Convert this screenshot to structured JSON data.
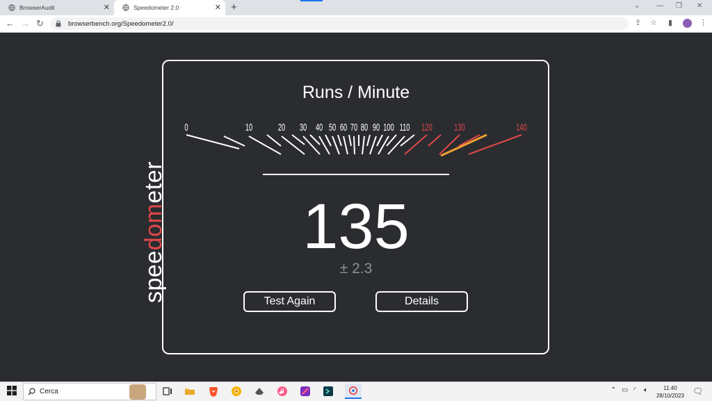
{
  "browser": {
    "tabs": [
      {
        "title": "BrowserAudit",
        "active": false
      },
      {
        "title": "Speedometer 2.0",
        "active": true
      }
    ],
    "new_tab_label": "+",
    "url": "browserbench.org/Speedometer2.0/"
  },
  "page": {
    "logo_text": "speedometer",
    "title": "Runs / Minute",
    "gauge_labels": [
      {
        "text": "0",
        "color": "#ffffff"
      },
      {
        "text": "10",
        "color": "#ffffff"
      },
      {
        "text": "20",
        "color": "#ffffff"
      },
      {
        "text": "30",
        "color": "#ffffff"
      },
      {
        "text": "40",
        "color": "#ffffff"
      },
      {
        "text": "50",
        "color": "#ffffff"
      },
      {
        "text": "60",
        "color": "#ffffff"
      },
      {
        "text": "70",
        "color": "#ffffff"
      },
      {
        "text": "80",
        "color": "#ffffff"
      },
      {
        "text": "90",
        "color": "#ffffff"
      },
      {
        "text": "100",
        "color": "#ffffff"
      },
      {
        "text": "110",
        "color": "#ffffff"
      },
      {
        "text": "120",
        "color": "#e04848"
      },
      {
        "text": "130",
        "color": "#e04848"
      },
      {
        "text": "140",
        "color": "#e04848"
      }
    ],
    "score": "135",
    "margin": "± 2.3",
    "test_again_label": "Test Again",
    "details_label": "Details",
    "colors": {
      "background": "#2a2c30",
      "accent_red": "#e04848",
      "needle_orange": "#f0a030"
    }
  },
  "taskbar": {
    "search_placeholder": "Cerca",
    "clock_time": "11:40",
    "clock_date": "28/10/2023"
  }
}
